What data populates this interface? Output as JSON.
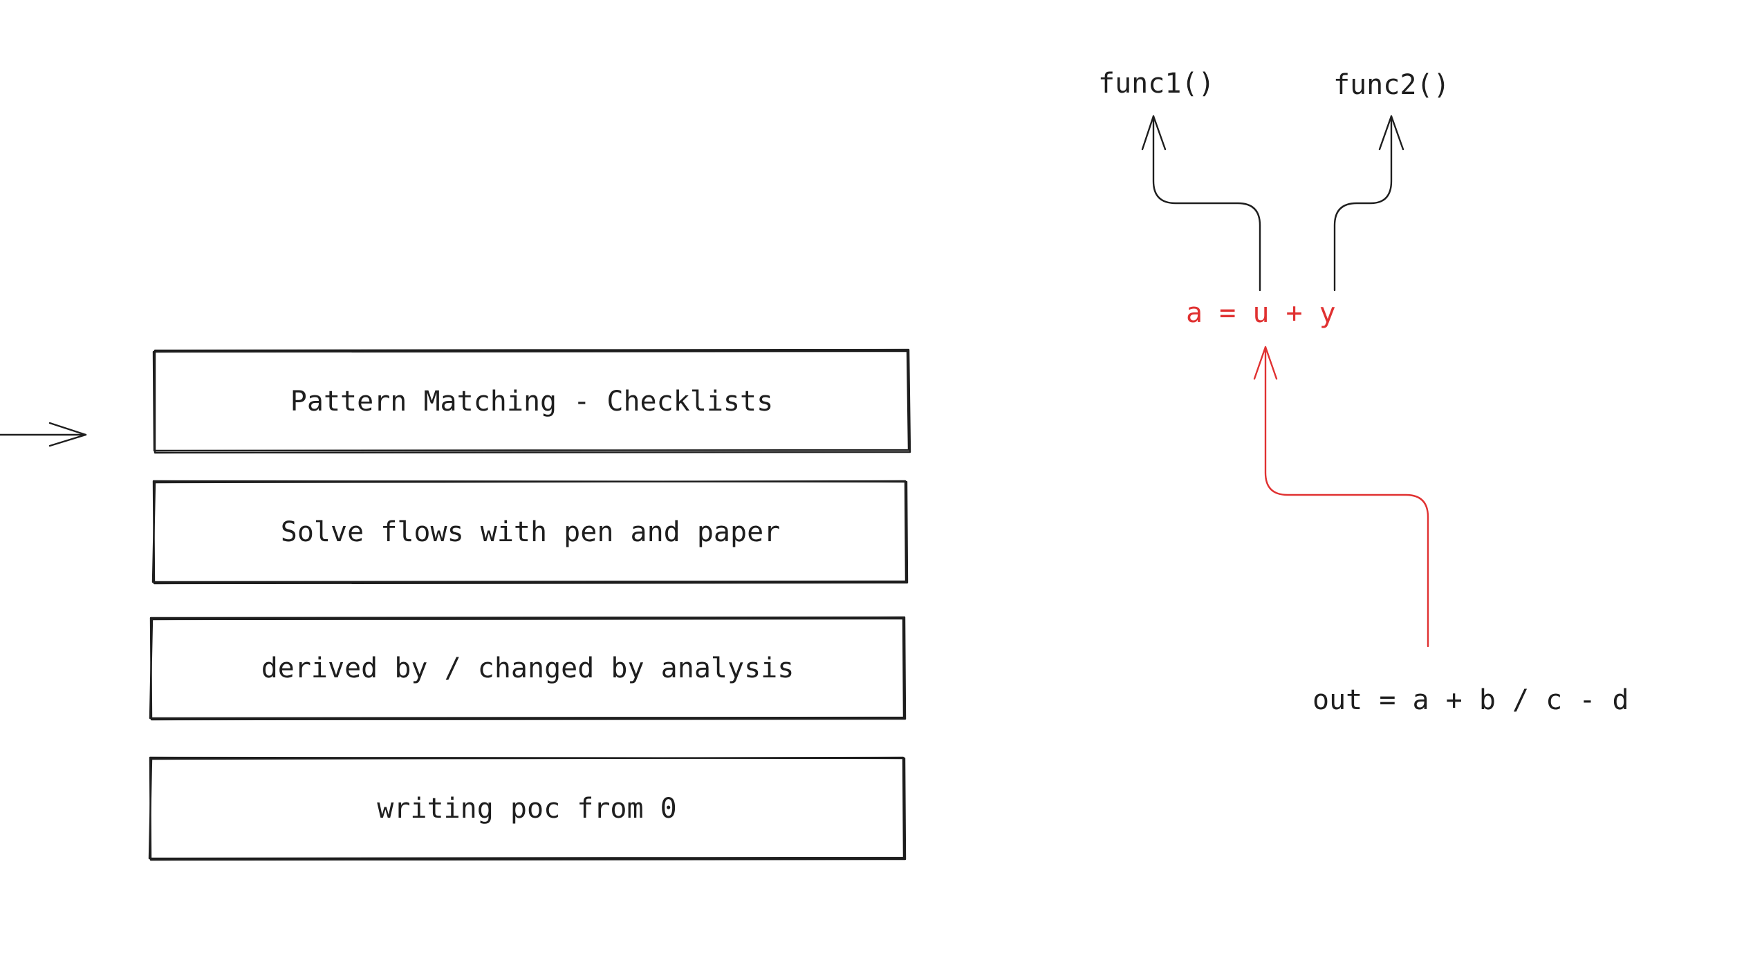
{
  "colors": {
    "ink": "#1e1e1e",
    "highlight": "#e03131",
    "background": "#ffffff"
  },
  "boxes": [
    {
      "label": "Pattern Matching - Checklists"
    },
    {
      "label": "Solve flows with pen and paper"
    },
    {
      "label": "derived by / changed by analysis"
    },
    {
      "label": "writing poc from 0"
    }
  ],
  "flow": {
    "func1": "func1()",
    "func2": "func2()",
    "assignment": "a = u + y",
    "expression": "out = a + b / c - d"
  }
}
